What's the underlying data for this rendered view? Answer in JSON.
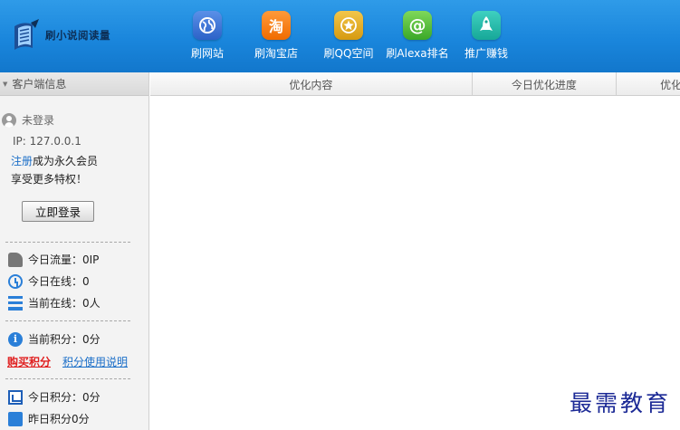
{
  "app": {
    "title": "刷小说阅读量"
  },
  "nav": [
    {
      "label": "刷网站",
      "icon": "globe-icon"
    },
    {
      "label": "刷淘宝店",
      "icon": "taobao-icon",
      "glyph": "淘"
    },
    {
      "label": "刷QQ空间",
      "icon": "star-icon"
    },
    {
      "label": "刷Alexa排名",
      "icon": "at-sign-icon"
    },
    {
      "label": "推广赚钱",
      "icon": "rocket-icon"
    }
  ],
  "sidebar": {
    "header": "客户端信息",
    "user_status": "未登录",
    "ip": "IP: 127.0.0.1",
    "register_link": "注册",
    "register_text": "成为永久会员",
    "perk_text": "享受更多特权！",
    "login_button": "立即登录",
    "stats": {
      "today_traffic": "今日流量：0IP",
      "today_online": "今日在线：0",
      "current_online": "当前在线：0人",
      "current_points": "当前积分：0分",
      "today_points": "今日积分：0分",
      "yesterday_points": "昨日积分0分"
    },
    "buy_points": "购买积分",
    "points_usage": "积分使用说明"
  },
  "table": {
    "columns": [
      "优化内容",
      "今日优化进度",
      "优化"
    ]
  },
  "watermark": "最需教育",
  "colors": {
    "topbar": "#1a86dc",
    "link": "#1a6ec8",
    "buy": "#e02020",
    "watermark": "#1c2a96"
  }
}
